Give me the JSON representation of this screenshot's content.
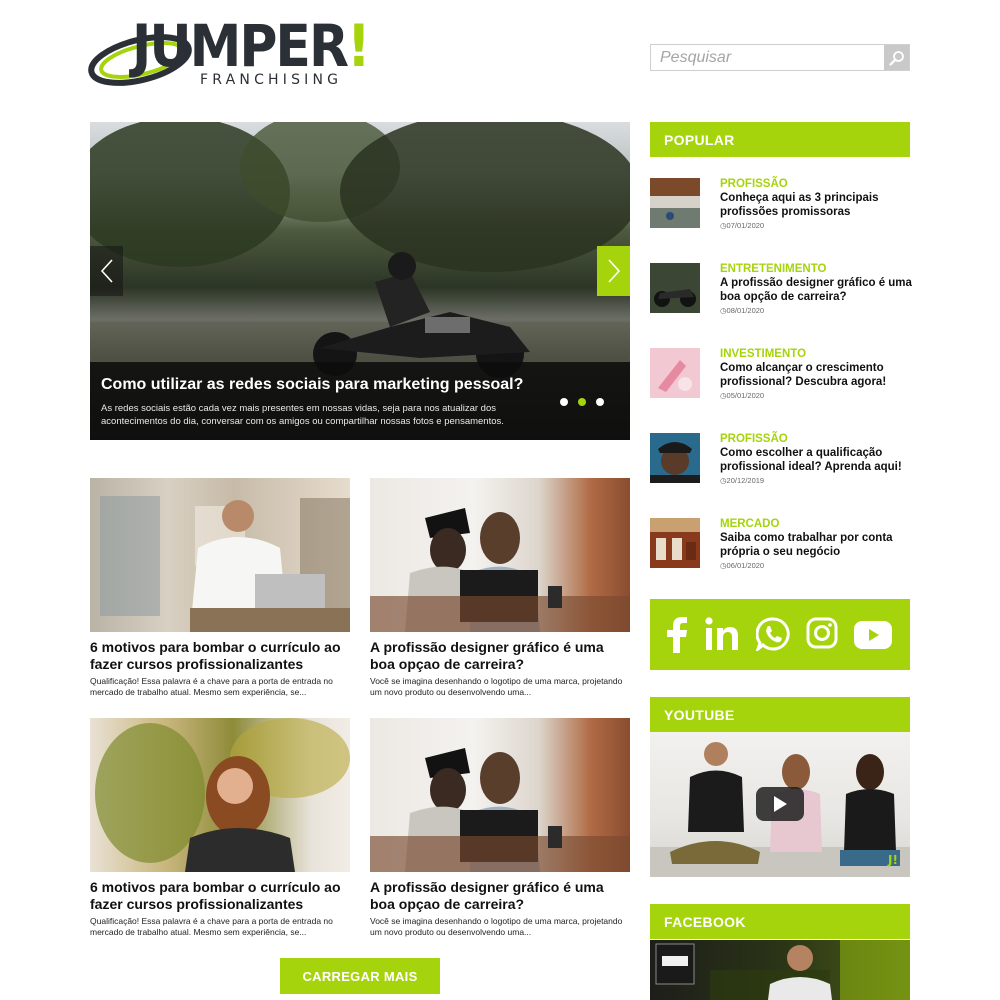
{
  "brand": {
    "name": "JUMPER",
    "exclamation": "!",
    "tagline": "FRANCHISING",
    "accent_color": "#a6d40c",
    "dark_color": "#2b2f36"
  },
  "search": {
    "placeholder": "Pesquisar",
    "icon": "search-icon"
  },
  "hero": {
    "title": "Como utilizar as redes sociais para marketing pessoal?",
    "description": "As redes sociais estão cada vez mais presentes em nossas vidas, seja para nos atualizar dos acontecimentos do dia, conversar com os amigos ou compartilhar nossas fotos e pensamentos.",
    "slide_count": 3,
    "active_slide": 2,
    "prev_icon": "chevron-left-icon",
    "next_icon": "chevron-right-icon"
  },
  "posts": [
    {
      "title": "6 motivos para bombar o currículo ao fazer cursos profissionalizantes",
      "excerpt": "Qualificação! Essa palavra é a chave para a porta de entrada no mercado de trabalho atual. Mesmo sem experiência, se..."
    },
    {
      "title": "A profissão designer gráfico é uma boa opçao de carreira?",
      "excerpt": "Você se imagina desenhando o logotipo de uma marca, projetando um novo produto ou desenvolvendo uma..."
    },
    {
      "title": "6 motivos para bombar o currículo ao fazer cursos profissionalizantes",
      "excerpt": "Qualificação! Essa palavra é a chave para a porta de entrada no mercado de trabalho atual. Mesmo sem experiência, se..."
    },
    {
      "title": "A profissão designer gráfico é uma boa opçao de carreira?",
      "excerpt": "Você se imagina desenhando o logotipo de uma marca, projetando um novo produto ou desenvolvendo uma..."
    }
  ],
  "load_more": "CARREGAR MAIS",
  "sidebar": {
    "popular_heading": "POPULAR",
    "popular": [
      {
        "category": "PROFISSÃO",
        "title": "Conheça aqui as 3 principais profissões promissoras",
        "date": "07/01/2020"
      },
      {
        "category": "ENTRETENIMENTO",
        "title": "A profissão designer gráfico é uma boa opção de carreira?",
        "date": "08/01/2020"
      },
      {
        "category": "INVESTIMENTO",
        "title": "Como alcançar o crescimento profissional? Descubra agora!",
        "date": "05/01/2020"
      },
      {
        "category": "PROFISSÃO",
        "title": "Como escolher a qualificação profissional ideal? Aprenda aqui!",
        "date": "20/12/2019"
      },
      {
        "category": "MERCADO",
        "title": "Saiba como trabalhar por conta própria o seu negócio",
        "date": "06/01/2020"
      }
    ],
    "social_icons": [
      "facebook-icon",
      "linkedin-icon",
      "whatsapp-icon",
      "instagram-icon",
      "youtube-icon"
    ],
    "youtube_heading": "YOUTUBE",
    "facebook_heading": "FACEBOOK"
  }
}
